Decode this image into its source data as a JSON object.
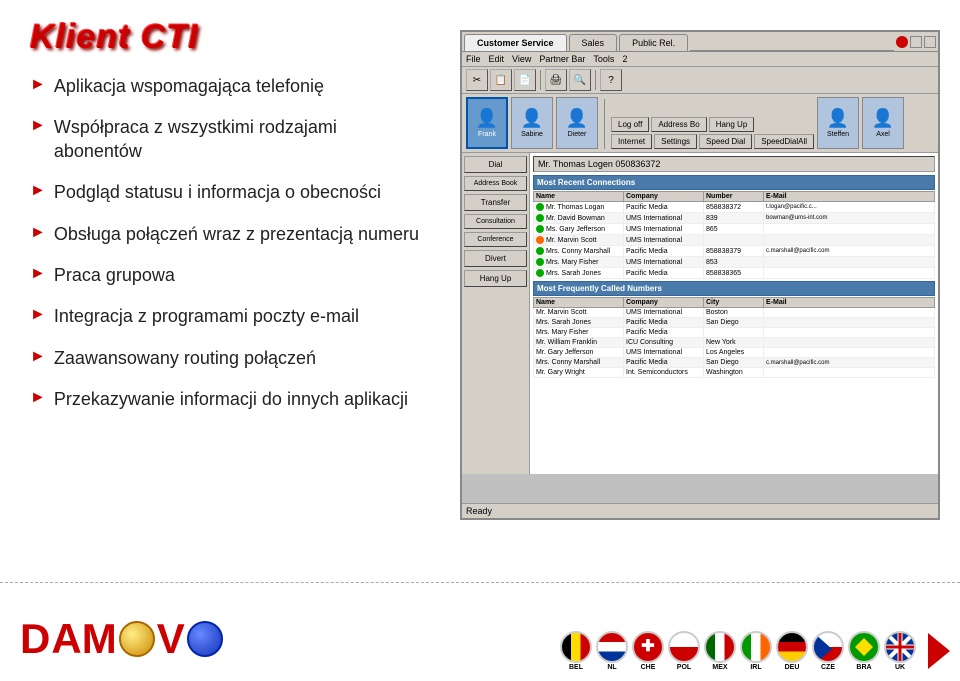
{
  "header": {
    "title": "Klient CTI"
  },
  "bullets": [
    {
      "id": 1,
      "text": "Aplikacja wspomagająca telefonię"
    },
    {
      "id": 2,
      "text": "Współpraca z wszystkimi rodzajami abonentów"
    },
    {
      "id": 3,
      "text": "Podgląd statusu i informacja o obecności"
    },
    {
      "id": 4,
      "text": "Obsługa połączeń wraz z prezentacją numeru"
    },
    {
      "id": 5,
      "text": "Praca grupowa"
    },
    {
      "id": 6,
      "text": "Integracja z programami poczty e-mail"
    },
    {
      "id": 7,
      "text": "Zaawansowany routing połączeń"
    },
    {
      "id": 8,
      "text": "Przekazywanie informacji do innych aplikacji"
    }
  ],
  "app": {
    "tabs": [
      "Customer Service",
      "Sales",
      "Public Rel."
    ],
    "active_tab": "Customer Service",
    "contacts": [
      "Frank",
      "Sabine",
      "Dieter",
      "Steffen",
      "Axel"
    ],
    "toolbar_buttons": [
      "Log off",
      "Address Bo",
      "Hang Up",
      "Internet",
      "Settings",
      "Speed Dial",
      "SpeedDialAll"
    ],
    "status_bar": "Mr. Thomas Logen  050836372",
    "sections": {
      "most_recent": "Most Recent Connections",
      "most_frequent": "Most Frequently Called Numbers"
    },
    "recent_connections": [
      {
        "name": "Mr. Thomas Logan",
        "company": "Pacific Media",
        "number": "858838372",
        "email": "t.logan@pacific.c..."
      },
      {
        "name": "Mr. David Bowman",
        "company": "UMS International",
        "number": "839",
        "email": "bowman@ums-int.com"
      },
      {
        "name": "Ms. Gary Jefferson",
        "company": "UMS International",
        "number": "865",
        "email": ""
      },
      {
        "name": "Mr. Marvin Scott",
        "company": "UMS International",
        "number": "",
        "email": ""
      },
      {
        "name": "Mrs. Conny Marshall",
        "company": "Pacific Media",
        "number": "858838379",
        "email": "c.marshall@pacific.com"
      },
      {
        "name": "Mrs. Mary Fisher",
        "company": "UMS International",
        "number": "853",
        "email": ""
      },
      {
        "name": "Mrs. Sarah Jones",
        "company": "Pacific Media",
        "number": "858838365",
        "email": ""
      }
    ],
    "frequent_numbers": [
      {
        "name": "Mr. Marvin Scott",
        "company": "UMS International",
        "city": "Boston",
        "email": ""
      },
      {
        "name": "Mrs. Sarah Jones",
        "company": "Pacific Media",
        "city": "San Diego",
        "email": ""
      },
      {
        "name": "Mrs. Mary Fisher",
        "company": "Pacific Media",
        "city": "",
        "email": ""
      },
      {
        "name": "Mr. William Franklin",
        "company": "ICU Consulting",
        "city": "New York",
        "email": ""
      },
      {
        "name": "Mr. Gary Jefferson",
        "company": "UMS International",
        "city": "Los Angeles",
        "email": ""
      },
      {
        "name": "Mrs. Conny Marshall",
        "company": "Pacific Media",
        "city": "San Diego",
        "email": "c.marshall@pacific.com"
      },
      {
        "name": "Mr. Gary Wright",
        "company": "Int. Semiconductors",
        "city": "Washington",
        "email": ""
      }
    ],
    "sidebar_buttons": [
      "Dial",
      "Address Book",
      "Transfer",
      "Consultation",
      "Conference",
      "Divert",
      "Hang Up"
    ],
    "ready_text": "Ready"
  },
  "footer": {
    "logo_text": "DAMOVO",
    "flags": [
      "BEL",
      "NL",
      "CHE",
      "POL",
      "MEX",
      "IRL",
      "DEU",
      "CZE",
      "BRA",
      "UK"
    ]
  }
}
